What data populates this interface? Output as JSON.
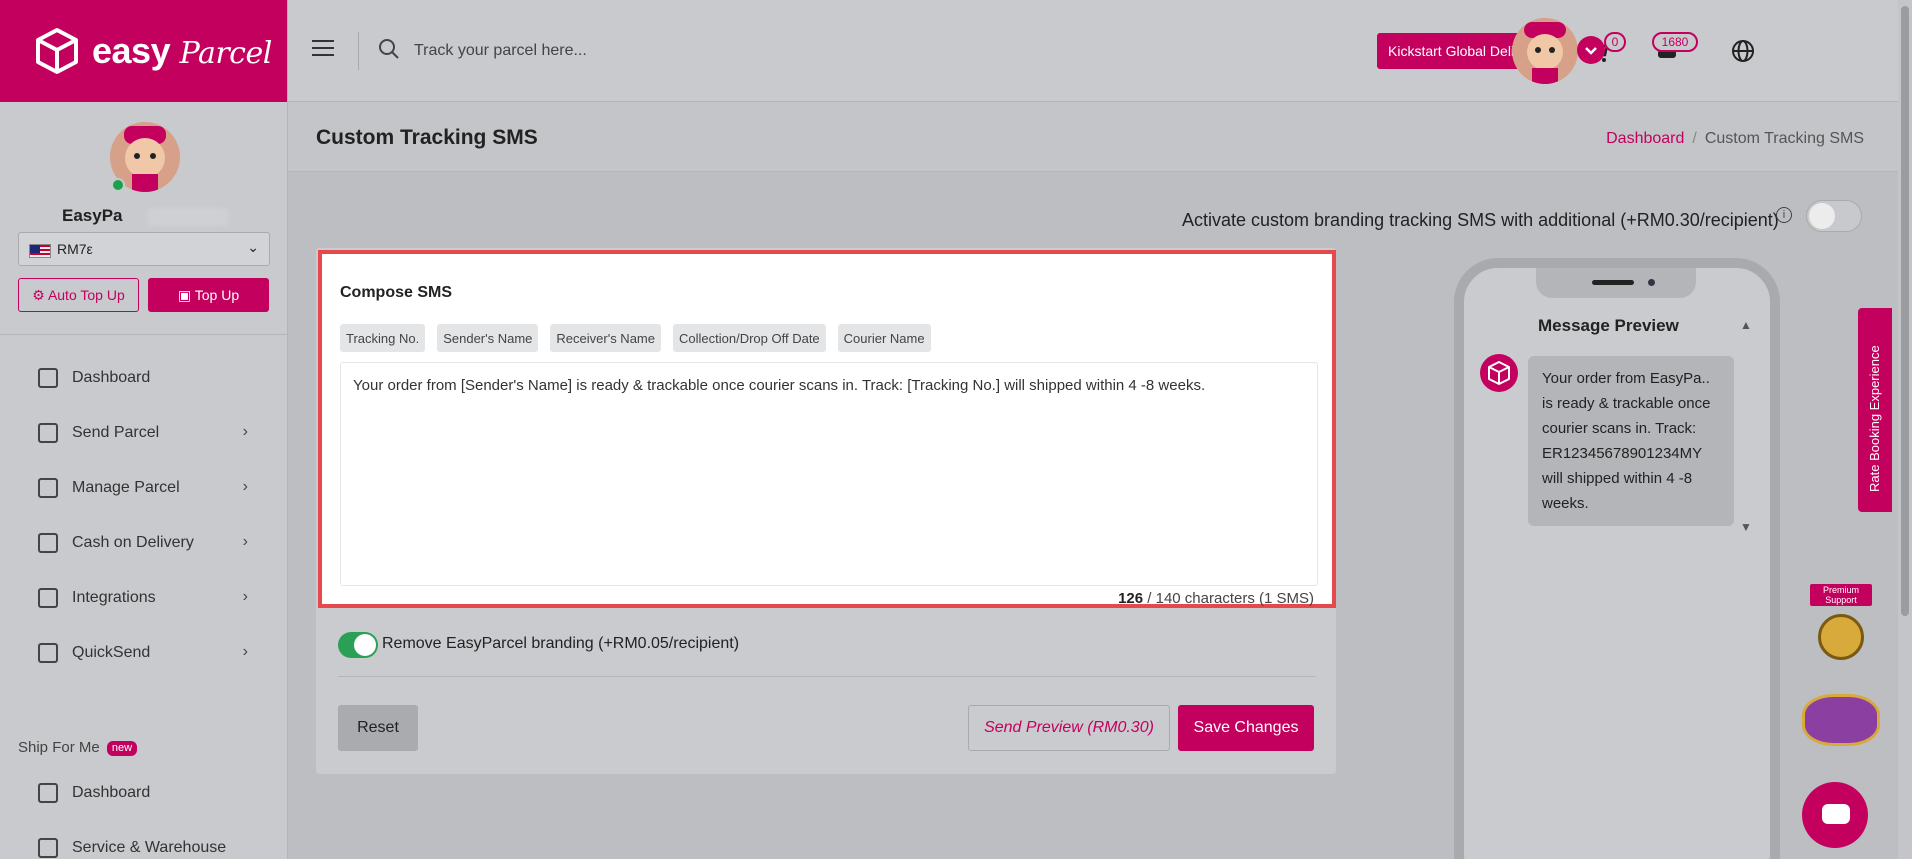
{
  "brand": {
    "name": "easy",
    "name_script": "Parcel",
    "accent": "#c4005f"
  },
  "topbar": {
    "search_placeholder": "Track your parcel here...",
    "kickstart_label": "Kickstart Global Delivery",
    "cart_count": "0",
    "coins": "1680"
  },
  "sidebar": {
    "user_name": "EasyPa",
    "wallet_value": "RM7ε",
    "auto_topup_label": "Auto Top Up",
    "topup_label": "Top Up",
    "nav": [
      {
        "label": "Dashboard"
      },
      {
        "label": "Send Parcel"
      },
      {
        "label": "Manage Parcel"
      },
      {
        "label": "Cash on Delivery"
      },
      {
        "label": "Integrations"
      },
      {
        "label": "QuickSend"
      }
    ],
    "ship_for_me": {
      "title": "Ship For Me",
      "badge": "new"
    },
    "nav2": [
      {
        "label": "Dashboard"
      },
      {
        "label": "Service & Warehouse"
      }
    ]
  },
  "header": {
    "title": "Custom Tracking SMS",
    "breadcrumb": [
      "Dashboard",
      "/",
      "Custom Tracking SMS"
    ]
  },
  "activate": {
    "label": "Activate custom branding tracking SMS with additional (+RM0.30/recipient)",
    "enabled": false
  },
  "compose": {
    "title": "Compose SMS",
    "chips": [
      "Tracking No.",
      "Sender's Name",
      "Receiver's Name",
      "Collection/Drop Off Date",
      "Courier Name"
    ],
    "message": "Your order from [Sender's Name] is ready & trackable once courier scans in. Track: [Tracking No.] will shipped within 4 -8 weeks.",
    "char_used": "126",
    "char_rest": " / 140 characters (1 SMS)"
  },
  "branding": {
    "label": "Remove EasyParcel branding (+RM0.05/recipient)",
    "enabled": true
  },
  "actions": {
    "reset": "Reset",
    "preview": "Send Preview (RM0.30)",
    "save": "Save Changes"
  },
  "preview": {
    "title": "Message Preview",
    "message": "Your order from EasyPa.. is ready & trackable once courier scans in. Track: ER12345678901234MY will shipped within 4 -8 weeks."
  },
  "widgets": {
    "rate_tab": "Rate Booking Experience",
    "premium": "Premium Support"
  }
}
